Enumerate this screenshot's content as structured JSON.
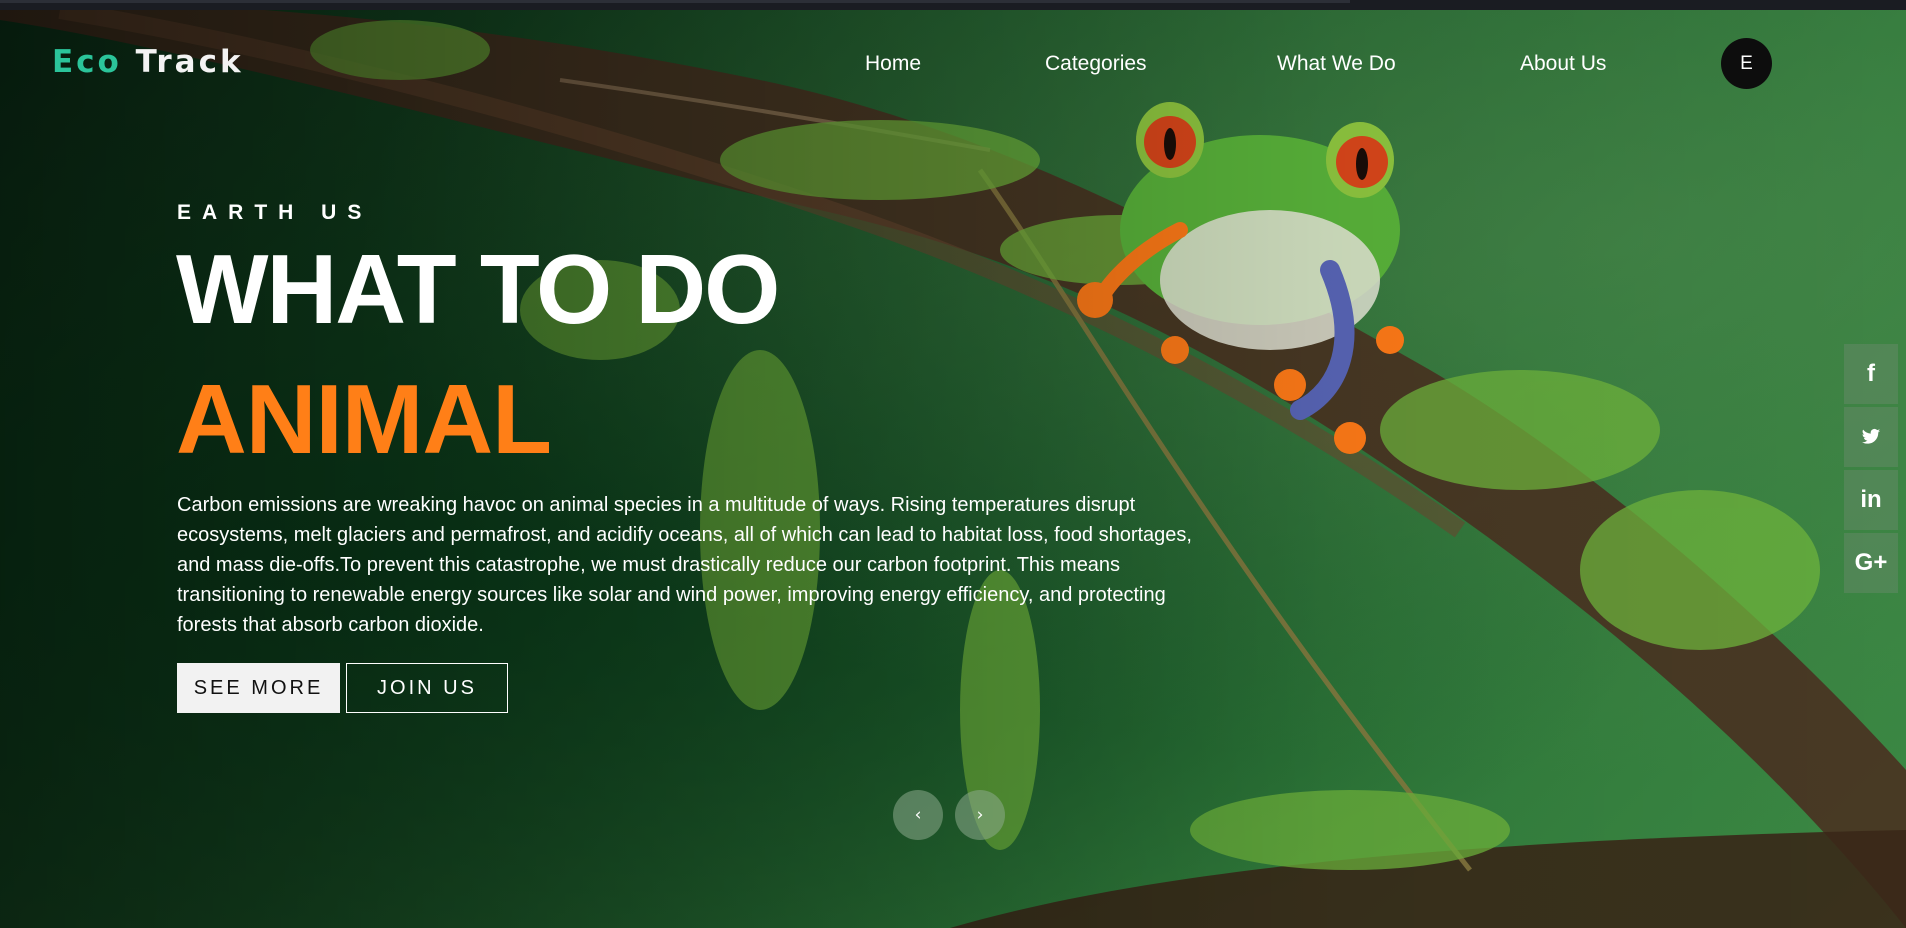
{
  "logo": {
    "part1": "Eco",
    "part2": "Track"
  },
  "nav": {
    "items": [
      "Home",
      "Categories",
      "What We Do",
      "About Us"
    ],
    "avatar_initial": "E"
  },
  "hero": {
    "eyebrow": "EARTH US",
    "headline_line1": "WHAT TO DO",
    "headline_line2": "ANIMAL",
    "body": "Carbon emissions are wreaking havoc on animal species in a multitude of ways. Rising temperatures disrupt ecosystems, melt glaciers and permafrost, and acidify oceans, all of which can lead to habitat loss, food shortages, and mass die-offs.To prevent this catastrophe, we must drastically reduce our carbon footprint. This means transitioning to renewable energy sources like solar and wind power, improving energy efficiency, and protecting forests that absorb carbon dioxide.",
    "primary_button": "SEE MORE",
    "secondary_button": "JOIN US"
  },
  "slider": {
    "prev": "‹",
    "next": "›"
  },
  "social": {
    "facebook": "f",
    "twitter": "t",
    "linkedin": "in",
    "googleplus": "G+"
  },
  "colors": {
    "logo_accent": "#2bc49a",
    "headline_accent": "#ff7f17",
    "avatar_bg": "#0d0d0d"
  }
}
